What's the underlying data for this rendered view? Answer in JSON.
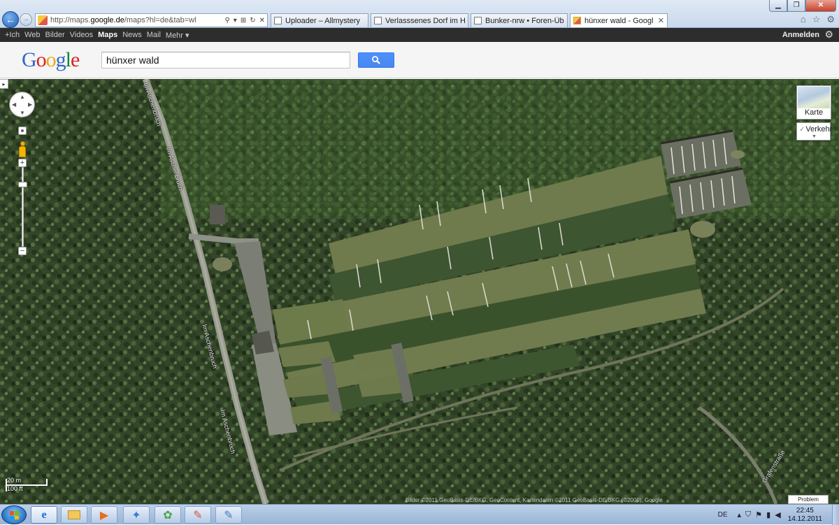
{
  "browser": {
    "address_url_prefix": "http://maps.",
    "address_url_domain": "google.de",
    "address_url_suffix": "/maps?hl=de&tab=wl",
    "address_tools": [
      "⚲",
      "▾",
      "⊞",
      "↻",
      "✕"
    ],
    "tabs": [
      {
        "label": "Uploader – Allmystery",
        "active": false
      },
      {
        "label": "Verlasssenes Dorf im Hünxerw...",
        "active": false
      },
      {
        "label": "Bunker-nrw • Foren-Übersicht",
        "active": false
      },
      {
        "label": "hünxer wald - Google Maps",
        "active": true
      }
    ],
    "tab_close_glyph": "✕"
  },
  "gbar": {
    "items": [
      "+Ich",
      "Web",
      "Bilder",
      "Videos",
      "Maps",
      "News",
      "Mail",
      "Mehr ▾"
    ],
    "active": "Maps",
    "signin": "Anmelden"
  },
  "search": {
    "logo": "Google",
    "query": "hünxer wald"
  },
  "map": {
    "map_type_label": "Karte",
    "traffic_label": "Verkehr",
    "road_labels": [
      "Im Aschenbruch",
      "Im Aschenbruch",
      "Im Aschenbruch",
      "Im Aschenbruch",
      "Grafenstraße"
    ],
    "scale_metric": "20 m",
    "scale_imperial": "100 ft",
    "copyright": "Bilder ©2011 GeoBasis-DE/BKG, GeoContent, Kartendaten ©2011 GeoBasis-DE/BKG (©2009), Google",
    "report_label": "Problem melden"
  },
  "taskbar": {
    "language": "DE",
    "time": "22:45",
    "date": "14.12.2011"
  },
  "colors": {
    "forest_dark": "#2b3a1f",
    "forest": "#3f5430",
    "clearing": "#6d7a4a",
    "road": "#8e9188",
    "google_blue": "#4d90fe"
  }
}
